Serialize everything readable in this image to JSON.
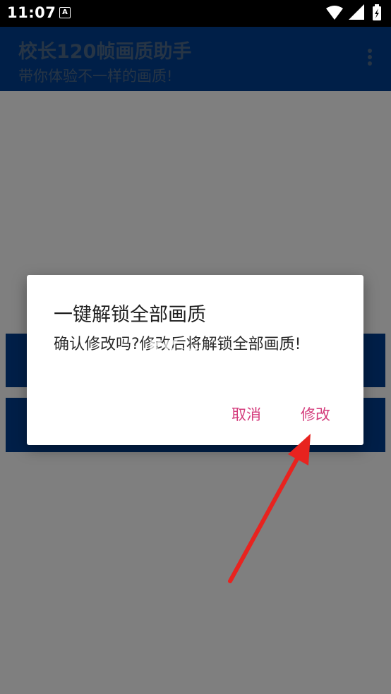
{
  "status_bar": {
    "time": "11:07",
    "badge": "A",
    "icons": [
      "wifi-icon",
      "signal-icon",
      "battery-icon"
    ]
  },
  "app_bar": {
    "title": "校长120帧画质助手",
    "subtitle": "带你体验不一样的画质!",
    "menu_icon": "more-vert-icon",
    "color": "#003f91"
  },
  "dialog": {
    "title": "一键解锁全部画质",
    "message": "确认修改吗?修改后将解锁全部画质!",
    "cancel_label": "取消",
    "confirm_label": "修改",
    "accent_color": "#d43c7c"
  },
  "watermark": {
    "text": "KK",
    "suffix": ".com"
  },
  "annotation": {
    "type": "red-arrow-icon",
    "color": "#e8231f"
  }
}
